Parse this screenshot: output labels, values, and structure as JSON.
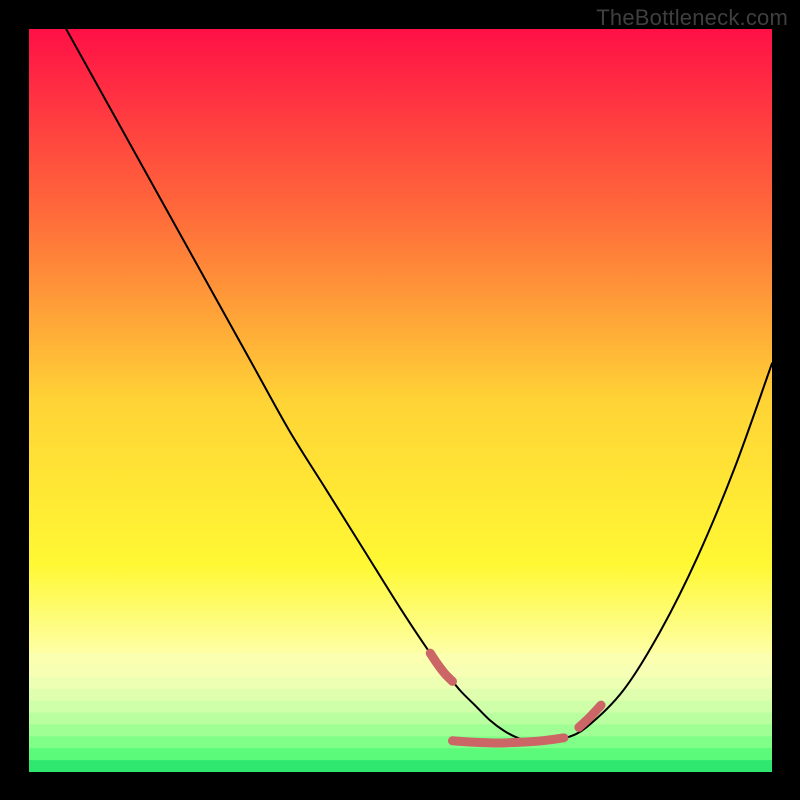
{
  "watermark": "TheBottleneck.com",
  "gradient_stops": [
    {
      "pct": 0,
      "color": "#ff1046"
    },
    {
      "pct": 25,
      "color": "#ff6b3a"
    },
    {
      "pct": 50,
      "color": "#ffd336"
    },
    {
      "pct": 72,
      "color": "#fff833"
    },
    {
      "pct": 84,
      "color": "#feffa5"
    },
    {
      "pct": 100,
      "color": "#feffa5"
    }
  ],
  "bottom_bands": [
    {
      "top_pct": 84.0,
      "height_pct": 1.6,
      "color": "#fbffb0"
    },
    {
      "top_pct": 85.6,
      "height_pct": 1.6,
      "color": "#f6ffb4"
    },
    {
      "top_pct": 87.2,
      "height_pct": 1.6,
      "color": "#edffb3"
    },
    {
      "top_pct": 88.8,
      "height_pct": 1.6,
      "color": "#e0ffae"
    },
    {
      "top_pct": 90.4,
      "height_pct": 1.6,
      "color": "#cfffa8"
    },
    {
      "top_pct": 92.0,
      "height_pct": 1.6,
      "color": "#b9ff9f"
    },
    {
      "top_pct": 93.6,
      "height_pct": 1.6,
      "color": "#9fff95"
    },
    {
      "top_pct": 95.2,
      "height_pct": 1.6,
      "color": "#7fff88"
    },
    {
      "top_pct": 96.8,
      "height_pct": 1.6,
      "color": "#5bfa7b"
    },
    {
      "top_pct": 98.4,
      "height_pct": 1.6,
      "color": "#2fe66f"
    }
  ],
  "chart_data": {
    "type": "line",
    "title": "",
    "xlabel": "",
    "ylabel": "",
    "xlim": [
      0,
      100
    ],
    "ylim": [
      0,
      100
    ],
    "series": [
      {
        "name": "curve",
        "x": [
          5,
          10,
          15,
          20,
          25,
          30,
          35,
          40,
          45,
          50,
          54,
          56,
          58,
          60,
          62,
          64,
          66,
          68,
          70,
          72,
          75,
          80,
          85,
          90,
          95,
          100
        ],
        "y": [
          100,
          91,
          82,
          73,
          64,
          55,
          46,
          38,
          30,
          22,
          16,
          13.5,
          11,
          9,
          7,
          5.5,
          4.5,
          4,
          4,
          4.5,
          6,
          11,
          19,
          29,
          41,
          55
        ],
        "stroke": "#000000",
        "stroke_width": 2
      },
      {
        "name": "highlight-left",
        "x": [
          54,
          55,
          56,
          57
        ],
        "y": [
          16,
          14.5,
          13.2,
          12.2
        ],
        "stroke": "#cc6666",
        "stroke_width": 9
      },
      {
        "name": "highlight-bottom",
        "x": [
          57,
          60,
          63,
          66,
          69,
          72
        ],
        "y": [
          4.2,
          4.0,
          3.9,
          4.0,
          4.2,
          4.6
        ],
        "stroke": "#cc6666",
        "stroke_width": 9
      },
      {
        "name": "highlight-right",
        "x": [
          74,
          75.5,
          77
        ],
        "y": [
          6.0,
          7.4,
          9.0
        ],
        "stroke": "#cc6666",
        "stroke_width": 9
      }
    ]
  }
}
